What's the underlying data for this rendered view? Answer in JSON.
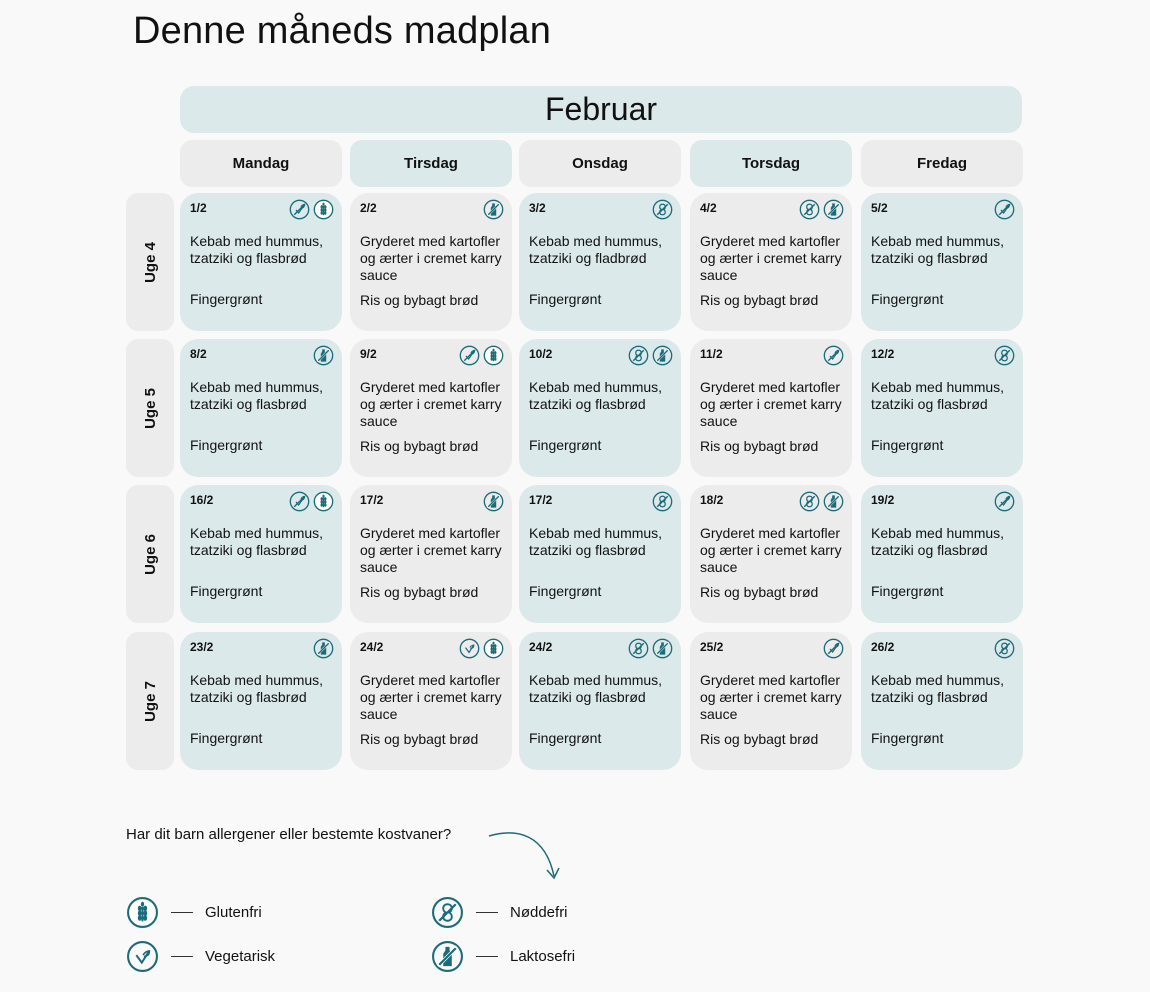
{
  "page": {
    "title": "Denne måneds madplan"
  },
  "month": "Februar",
  "days": [
    "Mandag",
    "Tirsdag",
    "Onsdag",
    "Torsdag",
    "Fredag"
  ],
  "weeks": [
    {
      "label": "Uge 4",
      "days": [
        {
          "date": "1/2",
          "icons": [
            "vegetarian-icon",
            "gluten-free-icon"
          ],
          "dish": "Kebab med hummus, tzatziki og flasbrød",
          "side": "Fingergrønt"
        },
        {
          "date": "2/2",
          "icons": [
            "lactose-free-icon"
          ],
          "dish": "Gryderet med kartofler og ærter i cremet karry sauce",
          "side": "Ris og bybagt brød"
        },
        {
          "date": "3/2",
          "icons": [
            "nut-free-icon"
          ],
          "dish": "Kebab med hummus, tzatziki og fladbrød",
          "side": "Fingergrønt"
        },
        {
          "date": "4/2",
          "icons": [
            "nut-free-icon",
            "lactose-free-icon"
          ],
          "dish": "Gryderet med kartofler og ærter i cremet karry sauce",
          "side": "Ris og bybagt brød"
        },
        {
          "date": "5/2",
          "icons": [
            "vegetarian-icon"
          ],
          "dish": "Kebab med hummus, tzatziki og flasbrød",
          "side": "Fingergrønt"
        }
      ]
    },
    {
      "label": "Uge 5",
      "days": [
        {
          "date": "8/2",
          "icons": [
            "lactose-free-icon"
          ],
          "dish": "Kebab med hummus, tzatziki og flasbrød",
          "side": "Fingergrønt"
        },
        {
          "date": "9/2",
          "icons": [
            "vegetarian-icon",
            "gluten-free-icon"
          ],
          "dish": "Gryderet med kartofler og ærter i cremet karry sauce",
          "side": "Ris og bybagt brød"
        },
        {
          "date": "10/2",
          "icons": [
            "nut-free-icon",
            "lactose-free-icon"
          ],
          "dish": "Kebab med hummus, tzatziki og flasbrød",
          "side": "Fingergrønt"
        },
        {
          "date": "11/2",
          "icons": [
            "vegetarian-icon"
          ],
          "dish": "Gryderet med kartofler og ærter i cremet karry sauce",
          "side": "Ris og bybagt brød"
        },
        {
          "date": "12/2",
          "icons": [
            "nut-free-icon"
          ],
          "dish": "Kebab med hummus, tzatziki og flasbrød",
          "side": "Fingergrønt"
        }
      ]
    },
    {
      "label": "Uge 6",
      "days": [
        {
          "date": "16/2",
          "icons": [
            "vegetarian-icon",
            "gluten-free-icon"
          ],
          "dish": "Kebab med hummus, tzatziki og flasbrød",
          "side": "Fingergrønt"
        },
        {
          "date": "17/2",
          "icons": [
            "lactose-free-icon"
          ],
          "dish": "Gryderet med kartofler og ærter i cremet karry sauce",
          "side": "Ris og bybagt brød"
        },
        {
          "date": "17/2",
          "icons": [
            "nut-free-icon"
          ],
          "dish": "Kebab med hummus, tzatziki og flasbrød",
          "side": "Fingergrønt"
        },
        {
          "date": "18/2",
          "icons": [
            "nut-free-icon",
            "lactose-free-icon"
          ],
          "dish": "Gryderet med kartofler og ærter i cremet karry sauce",
          "side": "Ris og bybagt brød"
        },
        {
          "date": "19/2",
          "icons": [
            "vegetarian-icon"
          ],
          "dish": "Kebab med hummus, tzatziki og flasbrød",
          "side": "Fingergrønt"
        }
      ]
    },
    {
      "label": "Uge 7",
      "days": [
        {
          "date": "23/2",
          "icons": [
            "lactose-free-icon"
          ],
          "dish": "Kebab med hummus, tzatziki og flasbrød",
          "side": "Fingergrønt"
        },
        {
          "date": "24/2",
          "icons": [
            "vegetarian-plain-icon",
            "gluten-free-icon"
          ],
          "dish": "Gryderet med kartofler og ærter i cremet karry sauce",
          "side": "Ris og bybagt brød"
        },
        {
          "date": "24/2",
          "icons": [
            "nut-free-icon",
            "lactose-free-icon"
          ],
          "dish": "Kebab med hummus, tzatziki og flasbrød",
          "side": "Fingergrønt"
        },
        {
          "date": "25/2",
          "icons": [
            "vegetarian-icon"
          ],
          "dish": "Gryderet med kartofler og ærter i cremet karry sauce",
          "side": "Ris og bybagt brød"
        },
        {
          "date": "26/2",
          "icons": [
            "nut-free-icon"
          ],
          "dish": "Kebab med hummus, tzatziki og flasbrød",
          "side": "Fingergrønt"
        }
      ]
    }
  ],
  "legend": {
    "question": "Har dit barn allergener eller bestemte kostvaner?",
    "items": [
      {
        "icon": "gluten-free-icon",
        "label": "Glutenfri"
      },
      {
        "icon": "nut-free-icon",
        "label": "Nøddefri"
      },
      {
        "icon": "vegetarian-plain-icon",
        "label": "Vegetarisk"
      },
      {
        "icon": "lactose-free-icon",
        "label": "Laktosefri"
      }
    ]
  },
  "colors": {
    "accent": "#1c6b78",
    "teal_bg": "#dbe9eb",
    "gray_bg": "#ececec",
    "page_bg": "#f9f9f9"
  }
}
